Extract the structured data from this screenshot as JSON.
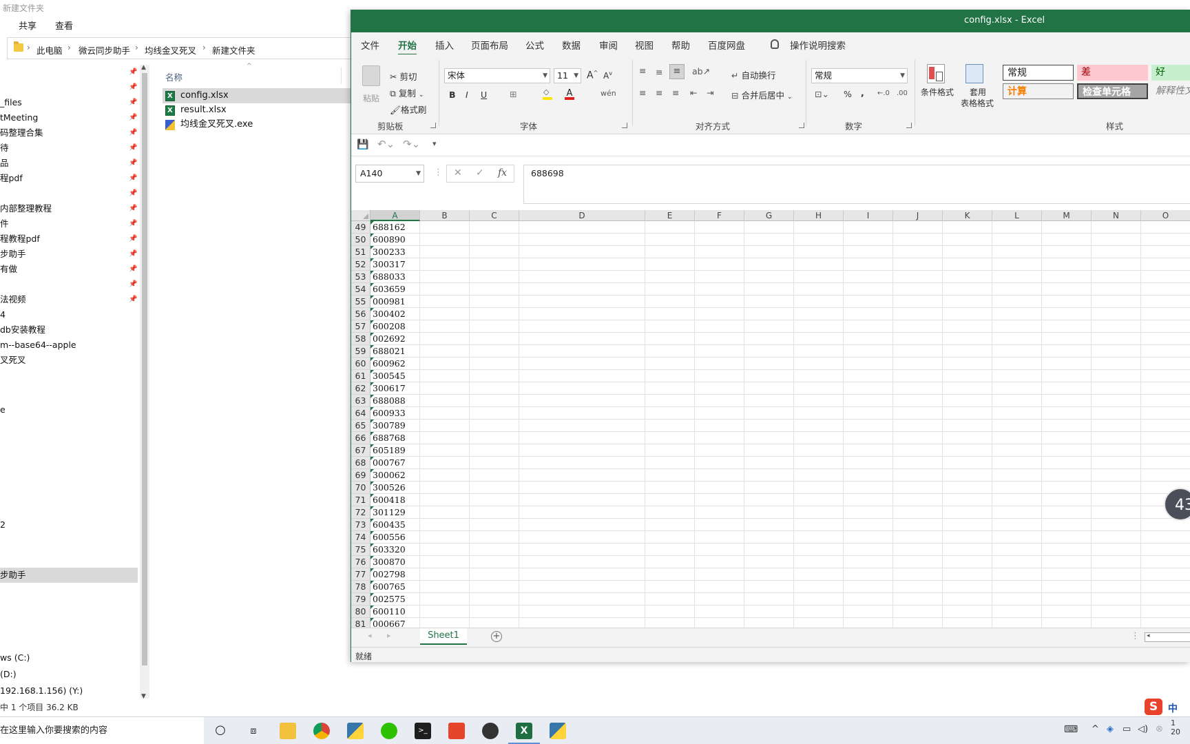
{
  "explorer": {
    "title": "新建文件夹",
    "ribbon_tabs": [
      "共享",
      "查看"
    ],
    "breadcrumb": [
      "此电脑",
      "微云同步助手",
      "均线金叉死叉",
      "新建文件夹"
    ],
    "nav_items": [
      {
        "label": "",
        "pinned": true
      },
      {
        "label": "",
        "pinned": true
      },
      {
        "label": "_files",
        "pinned": true
      },
      {
        "label": "tMeeting",
        "pinned": true
      },
      {
        "label": "码整理合集",
        "pinned": true
      },
      {
        "label": "待",
        "pinned": true
      },
      {
        "label": "品",
        "pinned": true
      },
      {
        "label": "程pdf",
        "pinned": true
      },
      {
        "label": "",
        "pinned": true
      },
      {
        "label": "内部整理教程",
        "pinned": true
      },
      {
        "label": "件",
        "pinned": true
      },
      {
        "label": "程教程pdf",
        "pinned": true
      },
      {
        "label": "步助手",
        "pinned": true
      },
      {
        "label": "有做",
        "pinned": true
      },
      {
        "label": "",
        "pinned": true
      },
      {
        "label": "法视频",
        "pinned": true
      },
      {
        "label": "4",
        "pinned": false
      },
      {
        "label": "db安装教程",
        "pinned": false
      },
      {
        "label": "m--base64--apple",
        "pinned": false
      },
      {
        "label": "叉死叉",
        "pinned": false
      },
      {
        "label": "",
        "pinned": false
      },
      {
        "label": "e",
        "pinned": false
      }
    ],
    "nav_lower": [
      {
        "label": "2"
      },
      {
        "label": "步助手",
        "selected": true
      }
    ],
    "drives": [
      "ws (C:)",
      "(D:)",
      "192.168.1.156) (Y:)"
    ],
    "column_header": "名称",
    "files": [
      {
        "name": "config.xlsx",
        "type": "xlsx",
        "selected": true
      },
      {
        "name": "result.xlsx",
        "type": "xlsx",
        "selected": false
      },
      {
        "name": "均线金叉死叉.exe",
        "type": "exe",
        "selected": false
      }
    ],
    "status_text": "中 1 个项目   36.2 KB"
  },
  "excel": {
    "title": "config.xlsx  -  Excel",
    "tabs": [
      "文件",
      "开始",
      "插入",
      "页面布局",
      "公式",
      "数据",
      "审阅",
      "视图",
      "帮助",
      "百度网盘"
    ],
    "active_tab": "开始",
    "search_hint": "操作说明搜索",
    "clipboard": {
      "paste": "粘贴",
      "cut": "剪切",
      "copy": "复制",
      "format_painter": "格式刷",
      "group": "剪贴板"
    },
    "font": {
      "name": "宋体",
      "size": "11",
      "group": "字体",
      "bold": "B",
      "italic": "I",
      "underline": "U"
    },
    "alignment": {
      "wrap": "自动换行",
      "merge": "合并后居中",
      "group": "对齐方式"
    },
    "number": {
      "format": "常规",
      "percent": "%",
      "comma": ",",
      "group": "数字"
    },
    "styles": {
      "conditional": "条件格式",
      "table_line1": "套用",
      "table_line2": "表格格式",
      "normal": "常规",
      "bad": "差",
      "good": "好",
      "calc": "计算",
      "check": "检查单元格",
      "explain": "解释性文",
      "group": "样式"
    },
    "name_box": "A140",
    "formula_value": "688698",
    "columns": [
      "A",
      "B",
      "C",
      "D",
      "E",
      "F",
      "G",
      "H",
      "I",
      "J",
      "K",
      "L",
      "M",
      "N",
      "O"
    ],
    "rows": [
      {
        "n": "49",
        "a": "688162"
      },
      {
        "n": "50",
        "a": "600890"
      },
      {
        "n": "51",
        "a": "300233"
      },
      {
        "n": "52",
        "a": "300317"
      },
      {
        "n": "53",
        "a": "688033"
      },
      {
        "n": "54",
        "a": "603659"
      },
      {
        "n": "55",
        "a": "000981"
      },
      {
        "n": "56",
        "a": "300402"
      },
      {
        "n": "57",
        "a": "600208"
      },
      {
        "n": "58",
        "a": "002692"
      },
      {
        "n": "59",
        "a": "688021"
      },
      {
        "n": "60",
        "a": "600962"
      },
      {
        "n": "61",
        "a": "300545"
      },
      {
        "n": "62",
        "a": "300617"
      },
      {
        "n": "63",
        "a": "688088"
      },
      {
        "n": "64",
        "a": "600933"
      },
      {
        "n": "65",
        "a": "300789"
      },
      {
        "n": "66",
        "a": "688768"
      },
      {
        "n": "67",
        "a": "605189"
      },
      {
        "n": "68",
        "a": "000767"
      },
      {
        "n": "69",
        "a": "300062"
      },
      {
        "n": "70",
        "a": "300526"
      },
      {
        "n": "71",
        "a": "600418"
      },
      {
        "n": "72",
        "a": "301129"
      },
      {
        "n": "73",
        "a": "600435"
      },
      {
        "n": "74",
        "a": "600556"
      },
      {
        "n": "75",
        "a": "603320"
      },
      {
        "n": "76",
        "a": "300870"
      },
      {
        "n": "77",
        "a": "002798"
      },
      {
        "n": "78",
        "a": "600765"
      },
      {
        "n": "79",
        "a": "002575"
      },
      {
        "n": "80",
        "a": "600110"
      },
      {
        "n": "81",
        "a": "000667"
      }
    ],
    "sheet_tab": "Sheet1",
    "status": "就绪",
    "accent": "#217346"
  },
  "overlay_timer": "43",
  "taskbar": {
    "search_placeholder": "在这里输入你要搜索的内容",
    "apps": [
      "cortana-icon",
      "task-view-icon",
      "file-explorer-icon",
      "chrome-icon",
      "python-icon",
      "wechat-icon",
      "terminal-icon",
      "app-red-icon",
      "obs-icon",
      "excel-icon",
      "python-idle-icon"
    ],
    "ime": "中"
  }
}
